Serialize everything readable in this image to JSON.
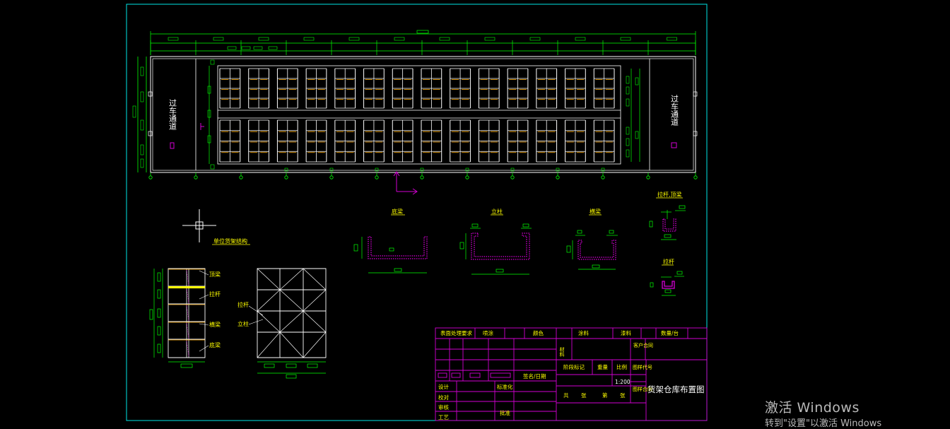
{
  "colors": {
    "background": "#000000",
    "frame": "#00e6e6",
    "wall": "#ffffff",
    "rack": "#ffffff",
    "beam": "#ffaa00",
    "dimension": "#00ff00",
    "label": "#ffff00",
    "title_block": "#d200d2",
    "ucs": "#d200d2"
  },
  "plan": {
    "aisle_left_label": "过车通道",
    "aisle_right_label": "过车通道"
  },
  "details": {
    "unit_rack_structure": "单位货架结构",
    "base_beam": "底梁",
    "upright": "立柱",
    "cross_beam": "横梁",
    "tie_rod_top": "拉杆,顶梁",
    "tie_rod": "拉杆"
  },
  "elevation_labels": {
    "top_beam": "顶梁",
    "tie_rod": "拉杆",
    "cross_beam": "横梁",
    "base_beam": "底梁"
  },
  "front_labels": {
    "tie_rod": "拉杆",
    "upright": "立柱"
  },
  "title_block": {
    "surface_treatment": "表面处理要求",
    "spray": "喷涂",
    "color": "颜色",
    "coating": "涂料",
    "paint": "漆料",
    "quantity_unit": "数量/台",
    "material": "材料",
    "customer_contract": "客户合同",
    "stage_mark": "阶段标记",
    "weight": "重量",
    "scale": "比例",
    "drawing_code": "图样代号",
    "scale_value": "1:200",
    "sign_date": "签名/日期",
    "design": "设计",
    "check": "校对",
    "review": "审核",
    "process": "工艺",
    "standardization": "标准化",
    "approve": "批准",
    "total": "共",
    "sheets1": "张",
    "page": "第",
    "sheets2": "张",
    "drawing_contract": "图样合同",
    "drawing_name": "货架仓库布置图"
  },
  "watermark": {
    "line1": "激活 Windows",
    "line2": "转到\"设置\"以激活 Windows"
  }
}
